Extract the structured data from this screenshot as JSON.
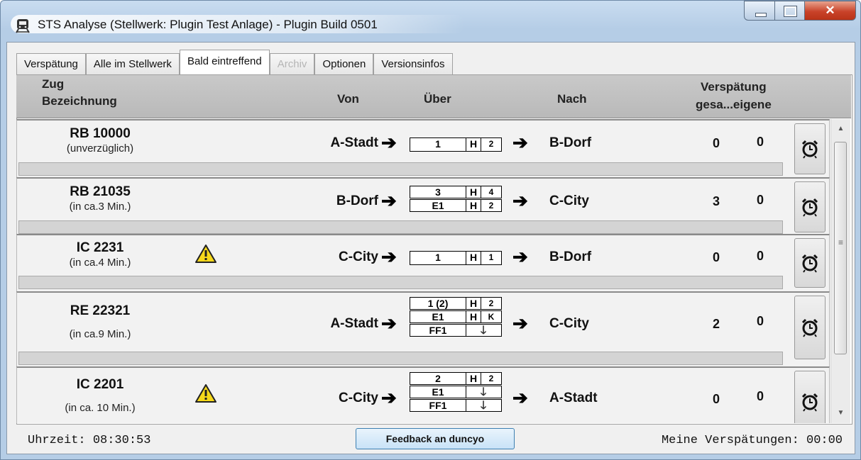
{
  "window": {
    "title": "STS Analyse (Stellwerk: Plugin Test Anlage) - Plugin Build 0501"
  },
  "tabs": [
    {
      "label": "Verspätung",
      "active": false,
      "disabled": false
    },
    {
      "label": "Alle im Stellwerk",
      "active": false,
      "disabled": false
    },
    {
      "label": "Bald eintreffend",
      "active": true,
      "disabled": false
    },
    {
      "label": "Archiv",
      "active": false,
      "disabled": true
    },
    {
      "label": "Optionen",
      "active": false,
      "disabled": false
    },
    {
      "label": "Versionsinfos",
      "active": false,
      "disabled": false
    }
  ],
  "header": {
    "zug_line1": "Zug",
    "zug_line2": "Bezeichnung",
    "von": "Von",
    "ueber": "Über",
    "nach": "Nach",
    "verspaetung": "Verspätung",
    "verspaetung_sub": "gesa...eigene"
  },
  "rows": [
    {
      "zug": "RB 10000",
      "when": "(unverzüglich)",
      "warning": false,
      "von": "A-Stadt",
      "nach": "B-Dorf",
      "gesamt": "0",
      "eigene": "0",
      "gleise": [
        {
          "gleis": "1",
          "type": "H",
          "extra": "2"
        }
      ]
    },
    {
      "zug": "RB 21035",
      "when": "(in ca.3 Min.)",
      "warning": false,
      "von": "B-Dorf",
      "nach": "C-City",
      "gesamt": "3",
      "eigene": "0",
      "gleise": [
        {
          "gleis": "3",
          "type": "H",
          "extra": "4"
        },
        {
          "gleis": "E1",
          "type": "H",
          "extra": "2"
        }
      ]
    },
    {
      "zug": "IC 2231",
      "when": "(in ca.4 Min.)",
      "warning": true,
      "von": "C-City",
      "nach": "B-Dorf",
      "gesamt": "0",
      "eigene": "0",
      "gleise": [
        {
          "gleis": "1",
          "type": "H",
          "extra": "1"
        }
      ]
    },
    {
      "zug": "RE 22321",
      "when": "(in ca.9 Min.)",
      "warning": false,
      "von": "A-Stadt",
      "nach": "C-City",
      "gesamt": "2",
      "eigene": "0",
      "gleise": [
        {
          "gleis": "1 (2)",
          "type": "H",
          "extra": "2"
        },
        {
          "gleis": "E1",
          "type": "H",
          "extra": "K"
        },
        {
          "gleis": "FF1",
          "type": "down",
          "extra": ""
        }
      ]
    },
    {
      "zug": "IC 2201",
      "when": "(in ca. 10 Min.)",
      "warning": true,
      "von": "C-City",
      "nach": "A-Stadt",
      "gesamt": "0",
      "eigene": "0",
      "gleise": [
        {
          "gleis": "2",
          "type": "H",
          "extra": "2"
        },
        {
          "gleis": "E1",
          "type": "down",
          "extra": ""
        },
        {
          "gleis": "FF1",
          "type": "down",
          "extra": ""
        }
      ]
    }
  ],
  "icons": {
    "arrow": "arrow-right-icon",
    "alarm": "alarm-clock-icon",
    "warning": "warning-icon",
    "down": "down-arrow-icon",
    "app": "train-icon"
  },
  "status": {
    "uhrzeit": "Uhrzeit: 08:30:53",
    "feedback_button": "Feedback an duncyo",
    "meine": "Meine Verspätungen: 00:00"
  },
  "colors": {
    "header_bg": "#bfbfbf",
    "row_bg": "#f2f2f2",
    "progress_bg": "#d4d4d4",
    "button_border": "#3c7fb1"
  }
}
